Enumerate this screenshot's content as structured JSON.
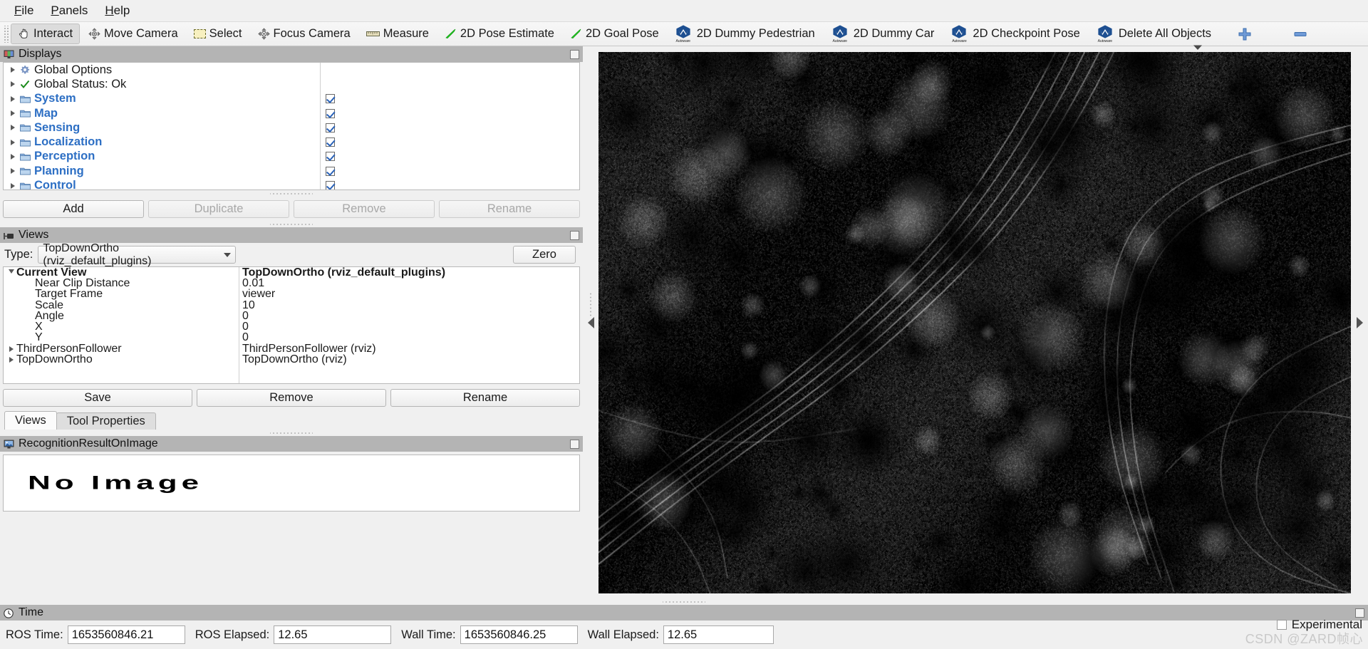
{
  "menubar": {
    "items": [
      {
        "label": "File",
        "mnemonic": "F"
      },
      {
        "label": "Panels",
        "mnemonic": "P"
      },
      {
        "label": "Help",
        "mnemonic": "H"
      }
    ]
  },
  "toolbar": {
    "items": [
      {
        "label": "Interact",
        "icon": "hand-cursor-icon",
        "active": true
      },
      {
        "label": "Move Camera",
        "icon": "move-camera-icon",
        "active": false
      },
      {
        "label": "Select",
        "icon": "select-rectangle-icon",
        "active": false
      },
      {
        "label": "Focus Camera",
        "icon": "focus-camera-icon",
        "active": false
      },
      {
        "label": "Measure",
        "icon": "ruler-icon",
        "active": false
      },
      {
        "label": "2D Pose Estimate",
        "icon": "green-arrow-icon",
        "active": false
      },
      {
        "label": "2D Goal Pose",
        "icon": "green-arrow-icon",
        "active": false
      },
      {
        "label": "2D Dummy Pedestrian",
        "icon": "autoware-logo-icon",
        "active": false
      },
      {
        "label": "2D Dummy Car",
        "icon": "autoware-logo-icon",
        "active": false
      },
      {
        "label": "2D Checkpoint Pose",
        "icon": "autoware-logo-icon",
        "active": false
      },
      {
        "label": "Delete All Objects",
        "icon": "autoware-logo-icon",
        "active": false
      }
    ],
    "autoware_mark": "Autoware",
    "add_tool_icon": "plus-icon",
    "remove_tool_icon": "minus-icon",
    "overflow_icon": "chevron-down-icon"
  },
  "displays_panel": {
    "title": "Displays",
    "title_icon": "display-monitor-icon",
    "rows": [
      {
        "label": "Global Options",
        "icon": "gear-icon",
        "bold": false,
        "blue": false,
        "checkbox": null
      },
      {
        "label": "Global Status: Ok",
        "icon": "check-icon",
        "bold": false,
        "blue": false,
        "checkbox": null
      },
      {
        "label": "System",
        "icon": "folder-icon",
        "bold": true,
        "blue": true,
        "checkbox": true
      },
      {
        "label": "Map",
        "icon": "folder-icon",
        "bold": true,
        "blue": true,
        "checkbox": true
      },
      {
        "label": "Sensing",
        "icon": "folder-icon",
        "bold": true,
        "blue": true,
        "checkbox": true
      },
      {
        "label": "Localization",
        "icon": "folder-icon",
        "bold": true,
        "blue": true,
        "checkbox": true
      },
      {
        "label": "Perception",
        "icon": "folder-icon",
        "bold": true,
        "blue": true,
        "checkbox": true
      },
      {
        "label": "Planning",
        "icon": "folder-icon",
        "bold": true,
        "blue": true,
        "checkbox": true
      },
      {
        "label": "Control",
        "icon": "folder-icon",
        "bold": true,
        "blue": true,
        "checkbox": true
      }
    ],
    "buttons": [
      {
        "label": "Add",
        "enabled": true
      },
      {
        "label": "Duplicate",
        "enabled": false
      },
      {
        "label": "Remove",
        "enabled": false
      },
      {
        "label": "Rename",
        "enabled": false
      }
    ]
  },
  "views_panel": {
    "title": "Views",
    "title_icon": "camera-view-icon",
    "type_label": "Type:",
    "type_value": "TopDownOrtho (rviz_default_plugins)",
    "zero_button": "Zero",
    "properties": [
      {
        "name": "Current View",
        "value": "TopDownOrtho (rviz_default_plugins)",
        "bold": true,
        "expandable": true,
        "expanded": true,
        "indent": 0
      },
      {
        "name": "Near Clip Distance",
        "value": "0.01",
        "bold": false,
        "expandable": false,
        "expanded": false,
        "indent": 1
      },
      {
        "name": "Target Frame",
        "value": "viewer",
        "bold": false,
        "expandable": false,
        "expanded": false,
        "indent": 1
      },
      {
        "name": "Scale",
        "value": "10",
        "bold": false,
        "expandable": false,
        "expanded": false,
        "indent": 1
      },
      {
        "name": "Angle",
        "value": "0",
        "bold": false,
        "expandable": false,
        "expanded": false,
        "indent": 1
      },
      {
        "name": "X",
        "value": "0",
        "bold": false,
        "expandable": false,
        "expanded": false,
        "indent": 1
      },
      {
        "name": "Y",
        "value": "0",
        "bold": false,
        "expandable": false,
        "expanded": false,
        "indent": 1
      },
      {
        "name": "ThirdPersonFollower",
        "value": "ThirdPersonFollower (rviz)",
        "bold": false,
        "expandable": true,
        "expanded": false,
        "indent": 0
      },
      {
        "name": "TopDownOrtho",
        "value": "TopDownOrtho (rviz)",
        "bold": false,
        "expandable": true,
        "expanded": false,
        "indent": 0
      }
    ],
    "buttons": [
      {
        "label": "Save",
        "enabled": true
      },
      {
        "label": "Remove",
        "enabled": true
      },
      {
        "label": "Rename",
        "enabled": true
      }
    ],
    "tabs": [
      {
        "label": "Views",
        "selected": true
      },
      {
        "label": "Tool Properties",
        "selected": false
      }
    ]
  },
  "image_panel": {
    "title": "RecognitionResultOnImage",
    "title_icon": "image-panel-icon",
    "placeholder": "No Image"
  },
  "time_panel": {
    "title": "Time",
    "title_icon": "clock-icon",
    "fields": [
      {
        "label": "ROS Time:",
        "value": "1653560846.21"
      },
      {
        "label": "ROS Elapsed:",
        "value": "12.65"
      },
      {
        "label": "Wall Time:",
        "value": "1653560846.25"
      },
      {
        "label": "Wall Elapsed:",
        "value": "12.65"
      }
    ],
    "experimental_label": "Experimental",
    "experimental_checked": false
  },
  "watermark": "CSDN @ZARD帧心",
  "viewport": {
    "name": "3d-pointcloud-view",
    "description": "Grayscale LiDAR point cloud map with road lane markings",
    "background": "#050505"
  },
  "colors": {
    "panel_bg": "#f0f0f0",
    "panel_title_bg": "#b4b4b4",
    "tree_blue": "#2d6fc4",
    "autoware_blue": "#1d4f91",
    "green_arrow": "#22cc22",
    "accent_checkbox": "#2a62b8"
  }
}
